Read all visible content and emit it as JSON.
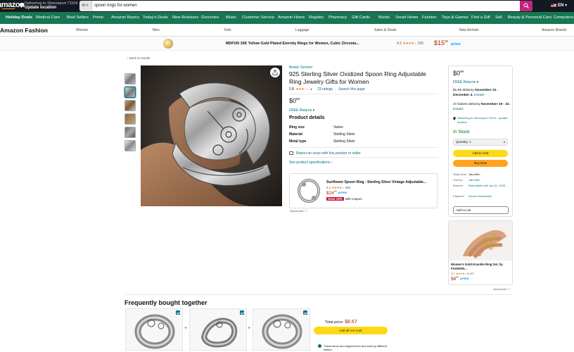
{
  "header": {
    "logo_text": "amazon",
    "deliver_line1": "Delivering to Shreveport 71104",
    "deliver_line2": "Update location",
    "search_dept": "All",
    "search_query": "spoon rings for women",
    "language": "EN"
  },
  "nav": {
    "items": [
      "Holiday Deals",
      "Medical Care",
      "Best Sellers",
      "Prime",
      "Amazon Basics",
      "Today's Deals",
      "New Releases",
      "Groceries",
      "Music",
      "Customer Service",
      "Amazon Home",
      "Registry",
      "Pharmacy",
      "Gift Cards",
      "Books",
      "Smart Home",
      "Fashion",
      "Toys & Games",
      "Find a Gift",
      "Sell",
      "Beauty & Personal Care",
      "Computers"
    ]
  },
  "subnav": {
    "brand": "Amazon Fashion",
    "items": [
      "Women",
      "Men",
      "Kids",
      "Luggage",
      "Sales & Deals",
      "New Arrivals",
      "Amazon Brands"
    ]
  },
  "sponsor_bar": {
    "title": "MDFUN 10K Yellow Gold Plated Eternity Rings for Women, Cubic Zirconia...",
    "rating": "4.2",
    "stars": "★★★★☆",
    "count": "236",
    "price_dollars": "$15",
    "price_cents": "99",
    "prime": "prime"
  },
  "back_link": "‹ Back to results",
  "product": {
    "brand_link": "Brand: Generic",
    "title": "925 Sterling Silver Oxidized Spoon Ring Adjustable Ring Jewelry Gifts for Women",
    "rating": "2.8",
    "stars": "★★★☆☆",
    "ratings_count": "23 ratings",
    "search_page": "Search this page",
    "price_dollars": "$0",
    "price_cents": "99",
    "returns": "FREE Returns",
    "details_heading": "Product details",
    "details": [
      {
        "k": "Ring size",
        "v": "Varies"
      },
      {
        "k": "Material",
        "v": "Sterling Silver"
      },
      {
        "k": "Metal type",
        "v": "Sterling Silver"
      }
    ],
    "report_link": "Report an issue with this product or seller",
    "specs_link": "See product specifications ›"
  },
  "ad_card": {
    "title": "Sunflower Spoon Ring - Sterling Silver Vintage Adjustable...",
    "rating": "4.1",
    "stars": "★★★★☆",
    "count": "285",
    "price_dollars": "$24",
    "price_cents": "99",
    "prime": "prime",
    "save_badge": "Save 10%",
    "coupon": "with coupon",
    "sponsored": "Sponsored ⓘ"
  },
  "buybox": {
    "price_dollars": "$0",
    "price_cents": "99",
    "returns": "FREE Returns",
    "delivery_prefix": "$1.99 delivery",
    "delivery_date": "November 22 - December 4.",
    "details_link": "Details",
    "fastest_prefix": "Or fastest delivery",
    "fastest_date": "November 19 - 22.",
    "deliver_to": "Delivering to Shreveport 71104 - Update location",
    "in_stock": "In Stock",
    "quantity": "Quantity: 1",
    "add_to_cart": "Add to Cart",
    "buy_now": "Buy Now",
    "ships_from_k": "Ships from",
    "ships_from_v": "JiaLaWin",
    "sold_by_k": "Sold by",
    "sold_by_v": "JiaLaWin",
    "returns_k": "Returns",
    "returns_v": "Returnable until Jan 31, 2025",
    "payment_k": "Payment",
    "payment_v": "Secure transaction",
    "add_to_list": "Add to List"
  },
  "side_ad": {
    "title": "Women's Gold Knuckle Ring Set, by FASHION...",
    "rating": "3.7",
    "stars": "★★★★☆",
    "count": "6,207",
    "price_dollars": "$8",
    "price_cents": "99",
    "prime": "prime",
    "sponsored": "Sponsored ⓘ"
  },
  "fbt": {
    "heading": "Frequently bought together",
    "total_label": "Total price:",
    "total_value": "$8.67",
    "add_all": "Add all 3 to Cart",
    "ship_note": "These items are shipped from and sold by different sellers."
  }
}
